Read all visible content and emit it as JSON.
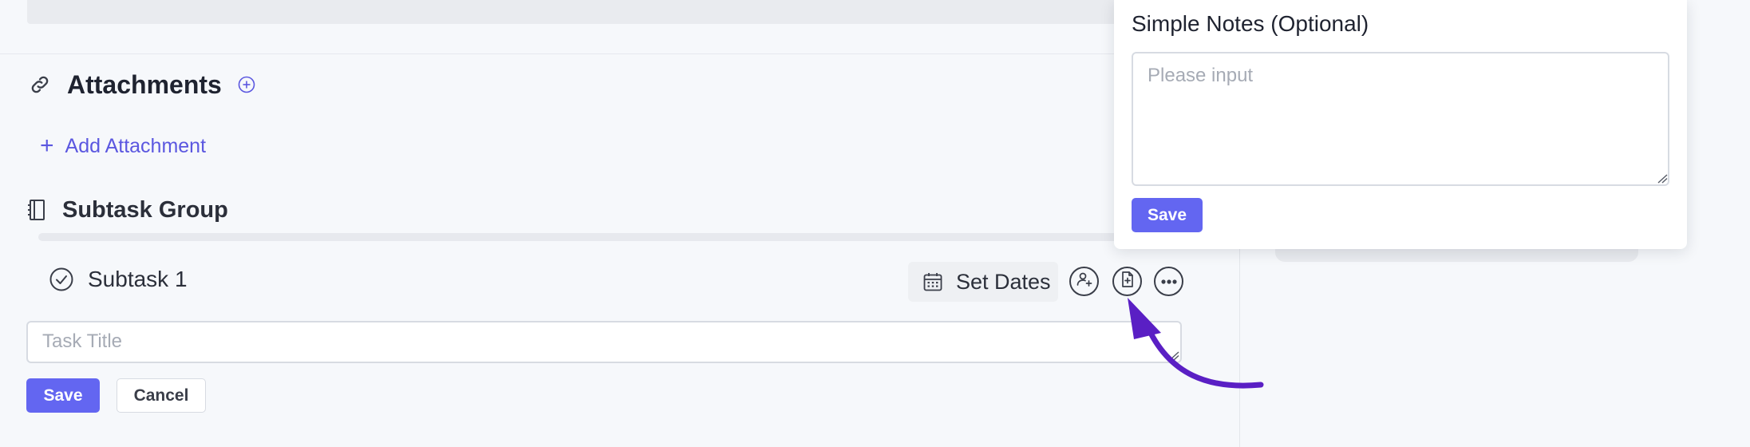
{
  "attachments": {
    "title": "Attachments",
    "add_label": "Add Attachment",
    "add_plus": "+"
  },
  "subtask_group": {
    "title": "Subtask Group",
    "subtasks": [
      {
        "name": "Subtask 1",
        "set_dates_label": "Set Dates"
      }
    ]
  },
  "new_task": {
    "placeholder": "Task Title",
    "save_label": "Save",
    "cancel_label": "Cancel"
  },
  "notes_popover": {
    "title": "Simple Notes (Optional)",
    "placeholder": "Please input",
    "save_label": "Save"
  },
  "colors": {
    "accent": "#6366f1",
    "link": "#5b57e0",
    "annotation_arrow": "#5a1fc4"
  }
}
